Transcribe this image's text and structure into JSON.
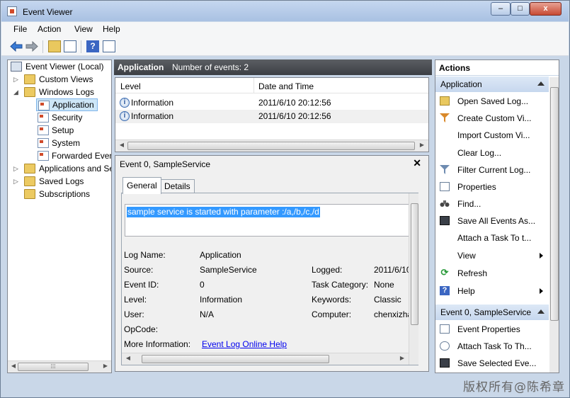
{
  "window": {
    "title": "Event Viewer",
    "min": "–",
    "max": "□",
    "close": "x"
  },
  "menu": [
    "File",
    "Action",
    "View",
    "Help"
  ],
  "tree": {
    "root": "Event Viewer (Local)",
    "custom_views": "Custom Views",
    "windows_logs": "Windows Logs",
    "application": "Application",
    "security": "Security",
    "setup": "Setup",
    "system": "System",
    "forwarded": "Forwarded Even",
    "apps_services": "Applications and Se",
    "saved_logs": "Saved Logs",
    "subscriptions": "Subscriptions"
  },
  "center": {
    "log_name": "Application",
    "event_count": "Number of events: 2",
    "columns": [
      "Level",
      "Date and Time"
    ],
    "rows": [
      {
        "level": "Information",
        "date": "2011/6/10 20:12:56"
      },
      {
        "level": "Information",
        "date": "2011/6/10 20:12:56"
      }
    ]
  },
  "detail": {
    "title": "Event 0, SampleService",
    "close": "✕",
    "tabs": [
      "General",
      "Details"
    ],
    "message": "sample service is started with parameter :/a,/b,/c,/d",
    "fields": {
      "log_name_label": "Log Name:",
      "log_name": "Application",
      "source_label": "Source:",
      "source": "SampleService",
      "logged_label": "Logged:",
      "logged": "2011/6/10",
      "event_id_label": "Event ID:",
      "event_id": "0",
      "task_label": "Task Category:",
      "task": "None",
      "level_label": "Level:",
      "level": "Information",
      "keywords_label": "Keywords:",
      "keywords": "Classic",
      "user_label": "User:",
      "user": "N/A",
      "computer_label": "Computer:",
      "computer": "chenxizha",
      "opcode_label": "OpCode:",
      "more_info_label": "More Information:",
      "more_info_link": "Event Log Online Help"
    }
  },
  "actions": {
    "header": "Actions",
    "section1": "Application",
    "items1": [
      "Open Saved Log...",
      "Create Custom Vi...",
      "Import Custom Vi...",
      "Clear Log...",
      "Filter Current Log...",
      "Properties",
      "Find...",
      "Save All Events As...",
      "Attach a Task To t...",
      "View",
      "Refresh",
      "Help"
    ],
    "section2": "Event 0, SampleService",
    "items2": [
      "Event Properties",
      "Attach Task To Th...",
      "Save Selected Eve..."
    ]
  },
  "watermark": "版权所有@陈希章",
  "colors": {
    "selection": "#3399ff",
    "header_dark": "#3c3f44",
    "section_blue": "#c6d7ee"
  }
}
